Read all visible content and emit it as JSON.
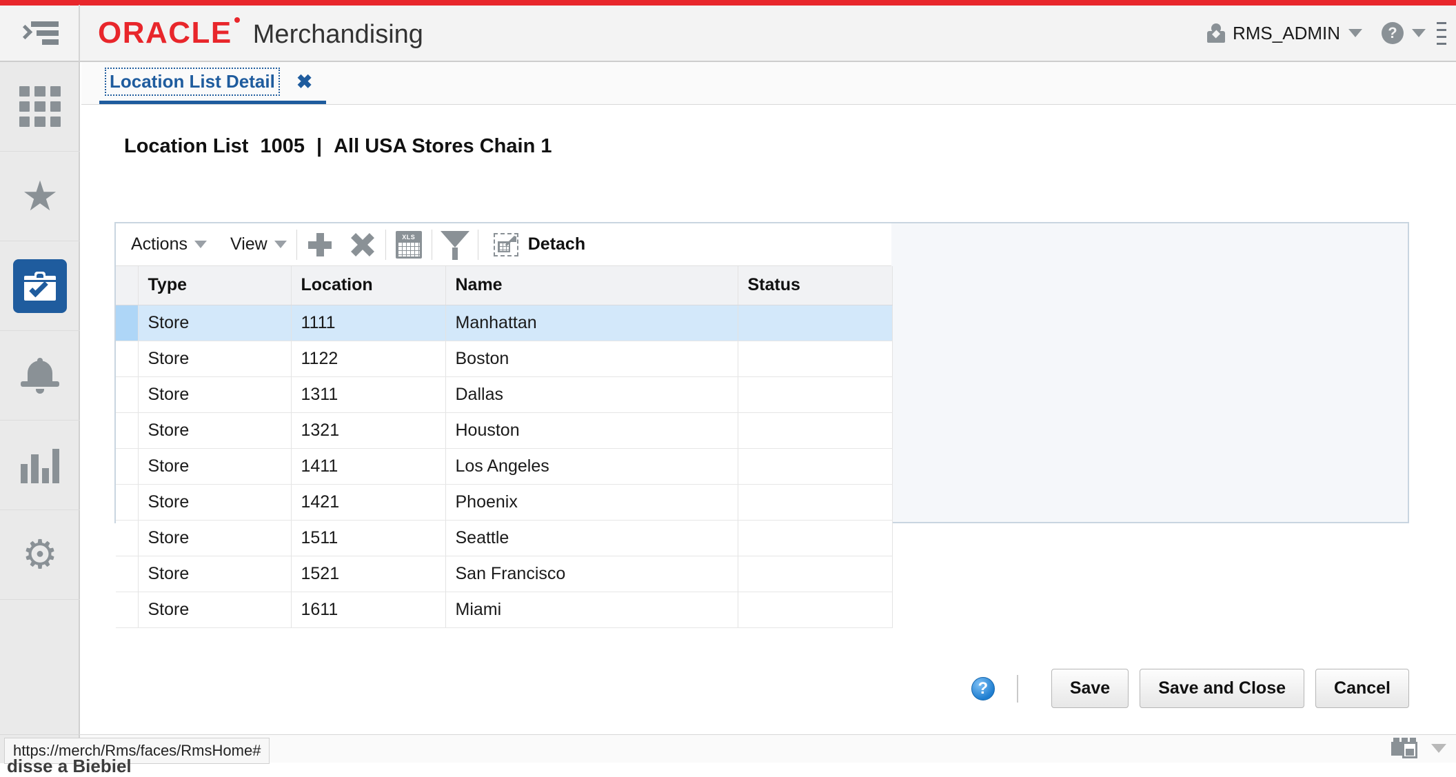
{
  "header": {
    "brand": "ORACLE",
    "app_name": "Merchandising",
    "user": "RMS_ADMIN",
    "help_glyph": "?",
    "menu_icon": "hamburger-collapse-icon"
  },
  "sidebar": {
    "items": [
      {
        "name": "apps",
        "icon": "grid-icon",
        "selected": false
      },
      {
        "name": "favorites",
        "icon": "star-icon",
        "selected": false
      },
      {
        "name": "tasks",
        "icon": "clipboard-check-icon",
        "selected": true
      },
      {
        "name": "notifications",
        "icon": "bell-icon",
        "selected": false
      },
      {
        "name": "reports",
        "icon": "bar-chart-icon",
        "selected": false
      },
      {
        "name": "settings",
        "icon": "gear-icon",
        "selected": false
      }
    ]
  },
  "tabs": [
    {
      "label": "Location List Detail",
      "close": "✖",
      "active": true
    }
  ],
  "page": {
    "title_label": "Location List",
    "title_id": "1005",
    "title_sep": "|",
    "title_name": "All USA Stores Chain 1"
  },
  "toolbar": {
    "actions_label": "Actions",
    "view_label": "View",
    "add_icon": "plus-icon",
    "delete_icon": "x-icon",
    "export_icon": "export-to-excel-icon",
    "export_badge": "XLS",
    "filter_icon": "funnel-icon",
    "detach_label": "Detach",
    "detach_icon": "detach-icon"
  },
  "table": {
    "columns": [
      "Type",
      "Location",
      "Name",
      "Status"
    ],
    "rows": [
      {
        "type": "Store",
        "location": "1111",
        "name": "Manhattan",
        "status": "",
        "selected": true
      },
      {
        "type": "Store",
        "location": "1122",
        "name": "Boston",
        "status": "",
        "selected": false
      },
      {
        "type": "Store",
        "location": "1311",
        "name": "Dallas",
        "status": "",
        "selected": false
      },
      {
        "type": "Store",
        "location": "1321",
        "name": "Houston",
        "status": "",
        "selected": false
      },
      {
        "type": "Store",
        "location": "1411",
        "name": "Los Angeles",
        "status": "",
        "selected": false
      },
      {
        "type": "Store",
        "location": "1421",
        "name": "Phoenix",
        "status": "",
        "selected": false
      },
      {
        "type": "Store",
        "location": "1511",
        "name": "Seattle",
        "status": "",
        "selected": false
      },
      {
        "type": "Store",
        "location": "1521",
        "name": "San Francisco",
        "status": "",
        "selected": false
      },
      {
        "type": "Store",
        "location": "1611",
        "name": "Miami",
        "status": "",
        "selected": false
      }
    ]
  },
  "footer": {
    "help_glyph": "?",
    "save_label": "Save",
    "save_close_label": "Save and Close",
    "cancel_label": "Cancel"
  },
  "status": {
    "url": "https://merch/Rms/faces/RmsHome#",
    "cut_text": "disse a Biebiel",
    "screenshot_icon": "screenshot-blocks-icon"
  },
  "colors": {
    "brand_red": "#e8262b",
    "accent_blue": "#1f5c9e",
    "selected_row": "#d3e8fa",
    "selected_gutter": "#aed6f7",
    "panel_bg": "#f5f7fa",
    "panel_border": "#c9d5e0"
  }
}
